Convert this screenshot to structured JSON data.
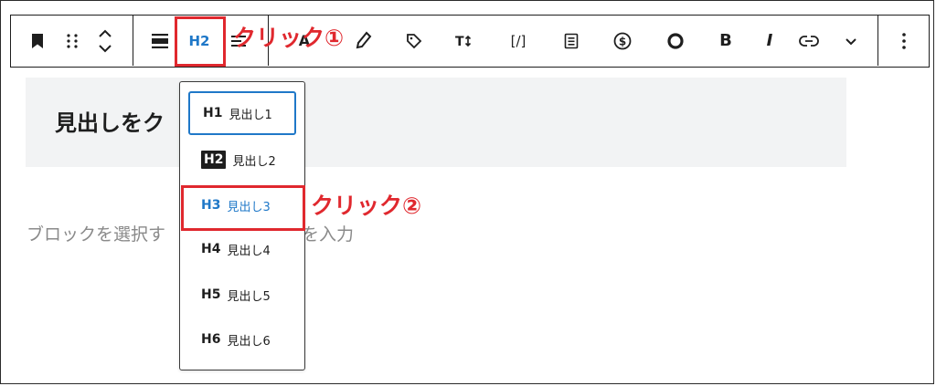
{
  "toolbar": {
    "heading_level": "H2",
    "text_color": "A",
    "code_label": "[/]",
    "bold": "B",
    "italic": "I"
  },
  "block": {
    "heading_text": "見出しをク",
    "placeholder": "ブロックを選択す",
    "placeholder_tail": "を入力"
  },
  "dropdown": {
    "items": [
      {
        "level": "H1",
        "label": "見出し1"
      },
      {
        "level": "H2",
        "label": "見出し2"
      },
      {
        "level": "H3",
        "label": "見出し3"
      },
      {
        "level": "H4",
        "label": "見出し4"
      },
      {
        "level": "H5",
        "label": "見出し5"
      },
      {
        "level": "H6",
        "label": "見出し6"
      }
    ]
  },
  "annotations": {
    "click1": "クリック①",
    "click2": "クリック②",
    "color": "#e0282e"
  },
  "colors": {
    "accent": "#1f78c8",
    "annotation_red": "#e0282e"
  }
}
